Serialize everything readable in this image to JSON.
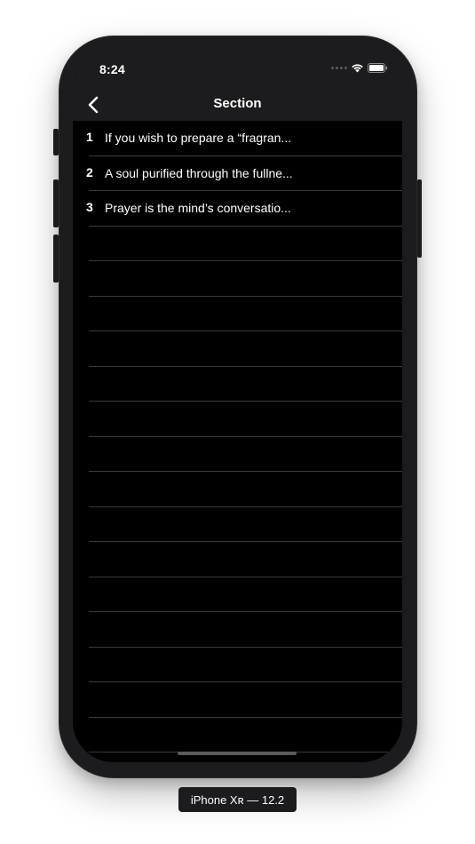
{
  "status_bar": {
    "time": "8:24",
    "icons": [
      "cellular-dots-icon",
      "wifi-icon",
      "battery-icon"
    ]
  },
  "nav": {
    "back_icon": "chevron-left-icon",
    "title": "Section"
  },
  "rows": [
    {
      "number": "1",
      "text": "If you wish to prepare a “fragran..."
    },
    {
      "number": "2",
      "text": "A soul purified through the fullne..."
    },
    {
      "number": "3",
      "text": "Prayer is the mind’s conversatio..."
    }
  ],
  "empty_row_count": 15,
  "device_label": "iPhone Xʀ — 12.2",
  "colors": {
    "screen_background": "#000000",
    "bar_background": "#1c1c1e",
    "separator": "#3a3a3c",
    "text": "#ffffff"
  }
}
